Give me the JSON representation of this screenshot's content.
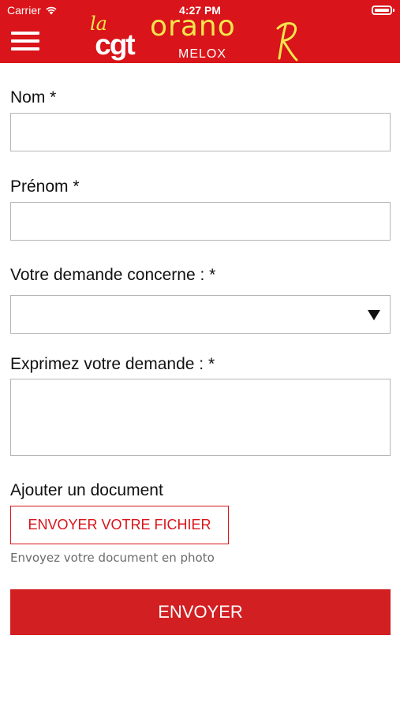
{
  "status_bar": {
    "carrier": "Carrier",
    "time": "4:27 PM",
    "wifi_icon": "wifi-icon",
    "battery_icon": "battery-icon"
  },
  "header": {
    "menu_icon": "hamburger-menu-icon",
    "logo_la": "la",
    "logo_cgt": "cgt",
    "logo_orano": "orano",
    "logo_melox": "MELOX",
    "logo_r": "R",
    "background_color": "#d9141a",
    "accent_color": "#f2e64c"
  },
  "form": {
    "nom": {
      "label": "Nom *",
      "value": ""
    },
    "prenom": {
      "label": "Prénom *",
      "value": ""
    },
    "demande_concerne": {
      "label": "Votre demande concerne : *",
      "selected": "",
      "arrow_icon": "dropdown-triangle-icon"
    },
    "expression": {
      "label": "Exprimez votre demande : *",
      "value": ""
    },
    "document": {
      "label": "Ajouter un document",
      "button_label": "ENVOYER VOTRE FICHIER",
      "helper": "Envoyez votre document en photo"
    },
    "submit_label": "ENVOYER",
    "primary_color": "#d21f22"
  }
}
